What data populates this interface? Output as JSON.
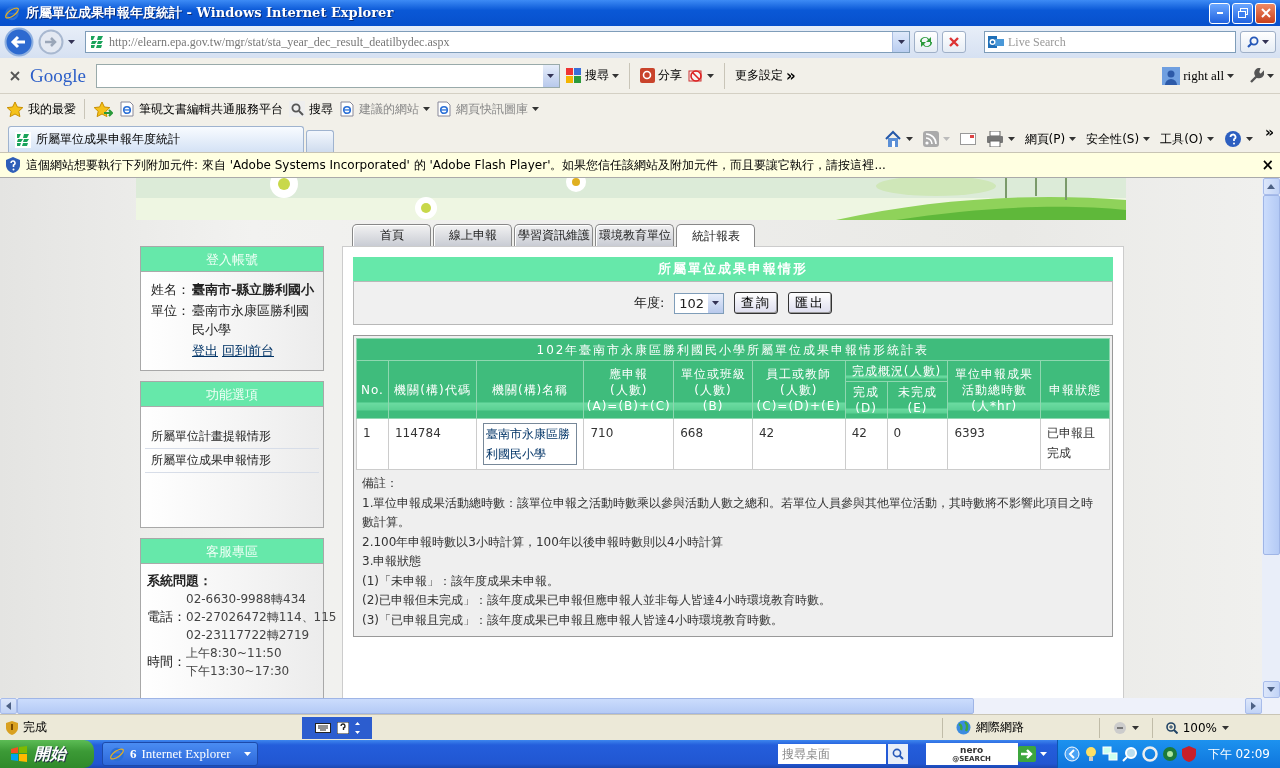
{
  "window": {
    "title": "所屬單位成果申報年度統計 - Windows Internet Explorer"
  },
  "address_bar": {
    "url": "http://elearn.epa.gov.tw/mgr/stat/sta_year_dec_result_deatilbydec.aspx"
  },
  "live_search": {
    "placeholder": "Live Search"
  },
  "google_toolbar": {
    "logo": "Google",
    "search_label": "搜尋",
    "share_label": "分享",
    "more_label": "更多設定",
    "more_glyph": "»",
    "user": "right all"
  },
  "favorites_bar": {
    "label": "我的最愛",
    "items": [
      {
        "label": "筆硯文書編輯共通服務平台",
        "kind": "page",
        "dropdown": false,
        "greyed": false
      },
      {
        "label": "搜尋",
        "kind": "search",
        "dropdown": false,
        "greyed": false
      },
      {
        "label": "建議的網站",
        "kind": "page",
        "dropdown": true,
        "greyed": true
      },
      {
        "label": "網頁快訊圖庫",
        "kind": "page",
        "dropdown": true,
        "greyed": true
      }
    ]
  },
  "browser_tabs": [
    {
      "label": "所屬單位成果申報年度統計",
      "selected": true
    }
  ],
  "command_bar": {
    "menus": [
      "網頁(P)",
      "安全性(S)",
      "工具(O)"
    ],
    "overflow": "»"
  },
  "info_bar": {
    "message": "這個網站想要執行下列附加元件: 來自 'Adobe Systems Incorporated' 的 'Adobe Flash Player'。如果您信任該網站及附加元件，而且要讓它執行，請按這裡...",
    "close": "×"
  },
  "site_tabs": [
    {
      "label": "首頁",
      "selected": false
    },
    {
      "label": "線上申報",
      "selected": false
    },
    {
      "label": "學習資訊維護",
      "selected": false
    },
    {
      "label": "環境教育單位",
      "selected": false
    },
    {
      "label": "統計報表",
      "selected": true
    }
  ],
  "login_panel": {
    "title": "登入帳號",
    "fields": [
      {
        "label": "姓名：",
        "value": "臺南市-縣立勝利國小",
        "kind": "bold"
      },
      {
        "label": "單位：",
        "value": "臺南市永康區勝利國民小學",
        "kind": "plain"
      }
    ],
    "links": [
      "登出",
      "回到前台"
    ]
  },
  "function_panel": {
    "title": "功能選項",
    "items": [
      "所屬單位計畫提報情形",
      "所屬單位成果申報情形"
    ]
  },
  "service_panel": {
    "title": "客服專區",
    "heading": "系統問題：",
    "rows": [
      {
        "label": "電話：",
        "values": [
          "02-6630-9988轉434",
          "02-27026472轉114、115",
          "02-23117722轉2719"
        ]
      },
      {
        "label": "時間：",
        "values": [
          "上午8:30~11:50",
          "下午13:30~17:30"
        ]
      }
    ]
  },
  "report": {
    "title": "所屬單位成果申報情形",
    "year_label": "年度:",
    "year": "102",
    "buttons": [
      "查詢",
      "匯出"
    ],
    "table": {
      "caption": "102年臺南市永康區勝利國民小學所屬單位成果申報情形統計表",
      "header_rows": [
        [
          {
            "lines": [
              "No."
            ],
            "rowspan": 2
          },
          {
            "lines": [
              "機關(構)代碼"
            ],
            "rowspan": 2
          },
          {
            "lines": [
              "機關(構)名稱"
            ],
            "rowspan": 2
          },
          {
            "lines": [
              "應申報",
              "(人數)",
              "(A)=(B)+(C)"
            ],
            "rowspan": 2
          },
          {
            "lines": [
              "單位或班級",
              "(人數)",
              "(B)"
            ],
            "rowspan": 2
          },
          {
            "lines": [
              "員工或教師",
              "(人數)",
              "(C)=(D)+(E)"
            ],
            "rowspan": 2
          },
          {
            "lines": [
              "完成概況(人數)"
            ],
            "colspan": 2
          },
          {
            "lines": [
              "單位申報成果",
              "活動總時數",
              "(人*hr)"
            ],
            "rowspan": 2
          },
          {
            "lines": [
              "申報狀態"
            ],
            "rowspan": 2
          }
        ],
        [
          {
            "lines": [
              "完成",
              "(D)"
            ]
          },
          {
            "lines": [
              "未完成",
              "(E)"
            ]
          }
        ]
      ],
      "rows": [
        {
          "cells": [
            "1",
            "114784",
            "臺南市永康區勝利國民小學",
            "710",
            "668",
            "42",
            "42",
            "0",
            "6393",
            "已申報且完成"
          ]
        }
      ]
    },
    "notes": {
      "heading": "備註：",
      "lines": [
        "1.單位申報成果活動總時數：該單位申報之活動時數乘以參與活動人數之總和。若單位人員參與其他單位活動，其時數將不影響此項目之時數計算。",
        "2.100年申報時數以3小時計算，100年以後申報時數則以4小時計算",
        "3.申報狀態",
        "(1)「未申報」：該年度成果未申報。",
        "(2)已申報但未完成」：該年度成果已申報但應申報人並非每人皆達4小時環境教育時數。",
        "(3)「已申報且完成」：該年度成果已申報且應申報人皆達4小時環境教育時數。"
      ]
    }
  },
  "status_bar": {
    "text": "完成",
    "zone": "網際網路",
    "zoom": "100%"
  },
  "taskbar": {
    "start": "開始",
    "task_count": "6",
    "task_label": "Internet Explorer",
    "search_placeholder": "搜尋桌面",
    "logo_top": "nero",
    "logo_bottom": "@SEARCH",
    "clock": "下午 02:09"
  }
}
